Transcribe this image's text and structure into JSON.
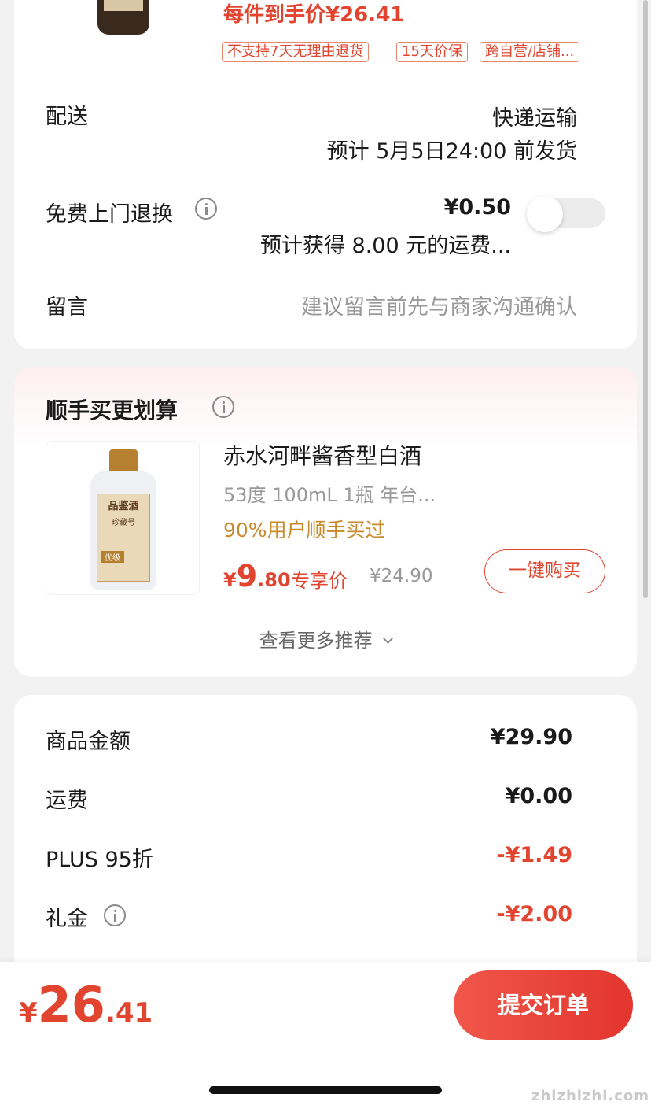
{
  "product": {
    "price_label": "每件到手价¥26.41",
    "tags": [
      "不支持7天无理由退货",
      "15天价保",
      "跨自营/店铺..."
    ]
  },
  "delivery": {
    "label": "配送",
    "method": "快递运输",
    "estimate": "预计 5月5日24:00 前发货"
  },
  "free_return": {
    "label": "免费上门退换",
    "price": "¥0.50",
    "note": "预计获得 8.00 元的运费...",
    "toggle_on": false
  },
  "message": {
    "label": "留言",
    "placeholder": "建议留言前先与商家沟通确认"
  },
  "recommend": {
    "title": "顺手买更划算",
    "item": {
      "name": "赤水河畔酱香型白酒",
      "spec": "53度 100mL 1瓶 年台...",
      "social_proof": "90%用户顺手买过",
      "price_currency": "¥",
      "price_int": "9",
      "price_dec": ".80",
      "price_tag": "专享价",
      "original_price": "¥24.90",
      "buy_button": "一键购买",
      "bottle_label": {
        "brand": "品鉴酒",
        "line": "珍藏号",
        "grade": "优级"
      }
    },
    "more": "查看更多推荐"
  },
  "summary": {
    "rows": [
      {
        "label": "商品金额",
        "value": "¥29.90"
      },
      {
        "label": "运费",
        "value": "¥0.00"
      },
      {
        "label": "PLUS 95折",
        "value": "-¥1.49"
      },
      {
        "label": "礼金",
        "value": "-¥2.00"
      }
    ]
  },
  "bottom_bar": {
    "currency": "¥",
    "total_int": "26",
    "total_dec": ".41",
    "submit": "提交订单"
  },
  "watermark": "zhizhizhi.com",
  "colors": {
    "accent": "#e2452f",
    "accent_orange": "#c98a2b",
    "background": "#f2f2f2"
  }
}
